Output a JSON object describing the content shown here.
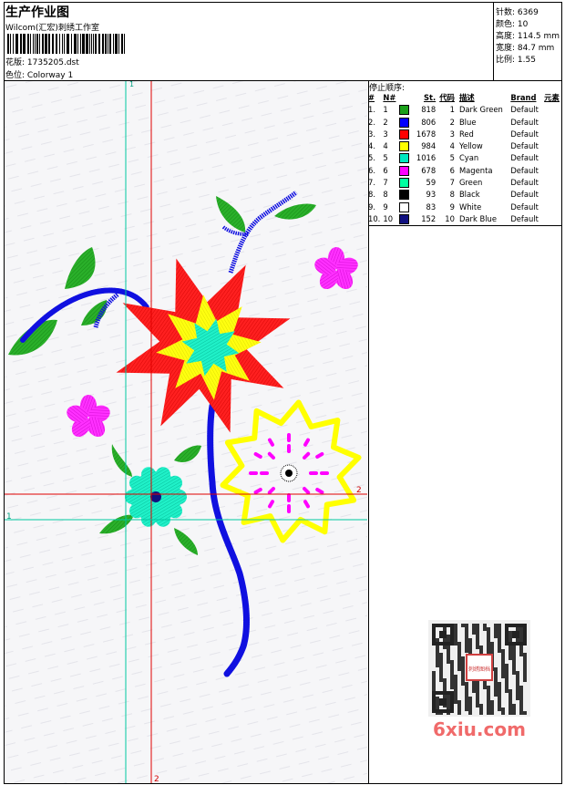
{
  "header": {
    "title": "生产作业图",
    "studio": "Wilcom(汇宏)刺绣工作室",
    "file": "花版: 1735205.dst",
    "colorway": "色位: Colorway 1"
  },
  "stats": {
    "stitches": "针数: 6369",
    "colors": "颜色: 10",
    "height": "高度: 114.5 mm",
    "width": "宽度: 84.7 mm",
    "scale": "比例: 1.55"
  },
  "stop_sequence": {
    "title": "停止顺序:",
    "headers": {
      "index": "#",
      "number": "N#",
      "stitches": "St.",
      "code": "代码",
      "description": "描述",
      "brand": "Brand",
      "element": "元素"
    },
    "rows": [
      {
        "index": "1.",
        "number": "1",
        "color": "#1aa01a",
        "stitches": "818",
        "code": "1",
        "description": "Dark Green",
        "brand": "Default"
      },
      {
        "index": "2.",
        "number": "2",
        "color": "#0000ff",
        "stitches": "806",
        "code": "2",
        "description": "Blue",
        "brand": "Default"
      },
      {
        "index": "3.",
        "number": "3",
        "color": "#ff0000",
        "stitches": "1678",
        "code": "3",
        "description": "Red",
        "brand": "Default"
      },
      {
        "index": "4.",
        "number": "4",
        "color": "#ffff00",
        "stitches": "984",
        "code": "4",
        "description": "Yellow",
        "brand": "Default"
      },
      {
        "index": "5.",
        "number": "5",
        "color": "#00e8c0",
        "stitches": "1016",
        "code": "5",
        "description": "Cyan",
        "brand": "Default"
      },
      {
        "index": "6.",
        "number": "6",
        "color": "#ff00ff",
        "stitches": "678",
        "code": "6",
        "description": "Magenta",
        "brand": "Default"
      },
      {
        "index": "7.",
        "number": "7",
        "color": "#00ffa0",
        "stitches": "59",
        "code": "7",
        "description": "Green",
        "brand": "Default"
      },
      {
        "index": "8.",
        "number": "8",
        "color": "#000000",
        "stitches": "93",
        "code": "8",
        "description": "Black",
        "brand": "Default"
      },
      {
        "index": "9.",
        "number": "9",
        "color": "#ffffff",
        "stitches": "83",
        "code": "9",
        "description": "White",
        "brand": "Default"
      },
      {
        "index": "10.",
        "number": "10",
        "color": "#101080",
        "stitches": "152",
        "code": "10",
        "description": "Dark Blue",
        "brand": "Default"
      }
    ]
  },
  "guides": {
    "v1": "1",
    "v2": "2",
    "h1": "1",
    "h2": "2"
  },
  "watermark": {
    "site": "6xiu.com",
    "seal": "刺绣图档"
  }
}
